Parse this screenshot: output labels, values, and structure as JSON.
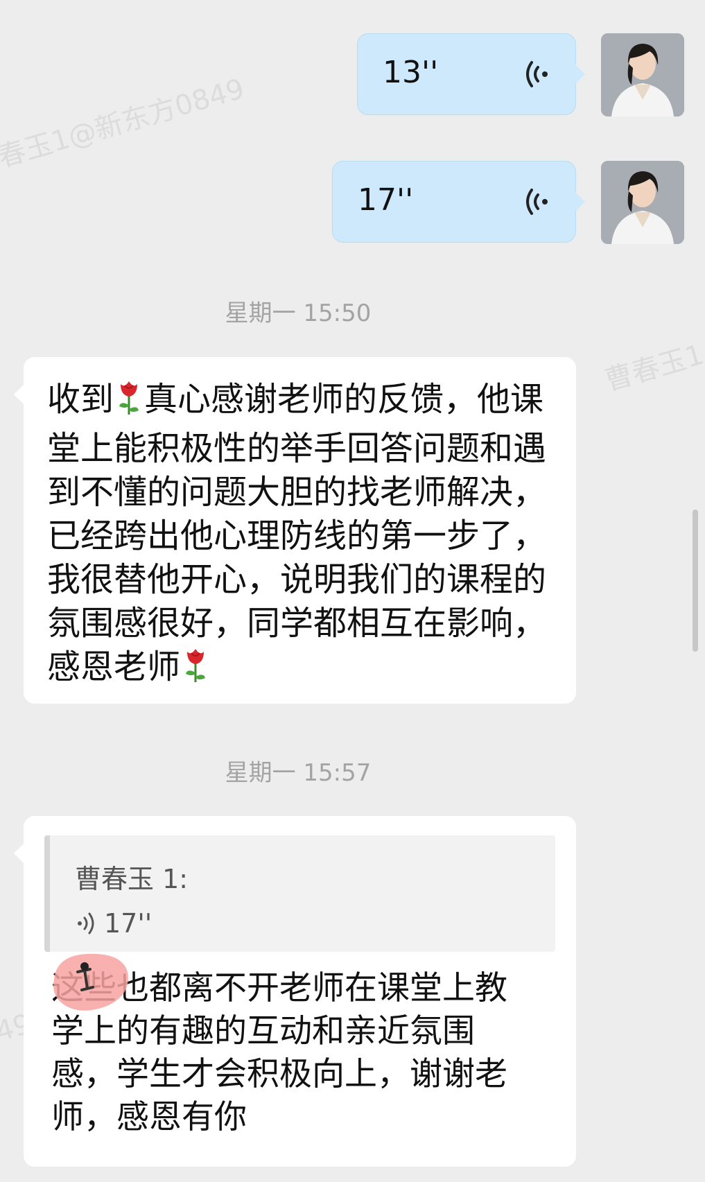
{
  "watermark": {
    "text_top_left": "春玉1@新东方0849",
    "text_right": "曹春玉1",
    "text_left_edge": "49"
  },
  "messages": {
    "voice_1": {
      "duration": "13''"
    },
    "voice_2": {
      "duration": "17''"
    },
    "time_1": "星期一 15:50",
    "text_1": {
      "parts": [
        "收到",
        "真心感谢老师的反馈，他课堂上能积极性的举手回答问题和遇到不懂的问题大胆的找老师解决，已经跨出他心理防线的第一步了，我很替他开心，说明我们的课程的氛围感很好，同学都相互在影响，感恩老师"
      ]
    },
    "time_2": "星期一 15:57",
    "reply": {
      "quote_name": "曹春玉 1:",
      "quote_voice_duration": "17''",
      "text_prefix": "these",
      "text": "这些也都离不开老师在课堂上教学上的有趣的互动和亲近氛围感，学生才会积极向上，谢谢老师，感恩有你"
    }
  },
  "colors": {
    "background": "#ededed",
    "outgoing_bubble": "#cde9fb",
    "incoming_bubble": "#ffffff",
    "timestamp": "#a3a3a3"
  }
}
